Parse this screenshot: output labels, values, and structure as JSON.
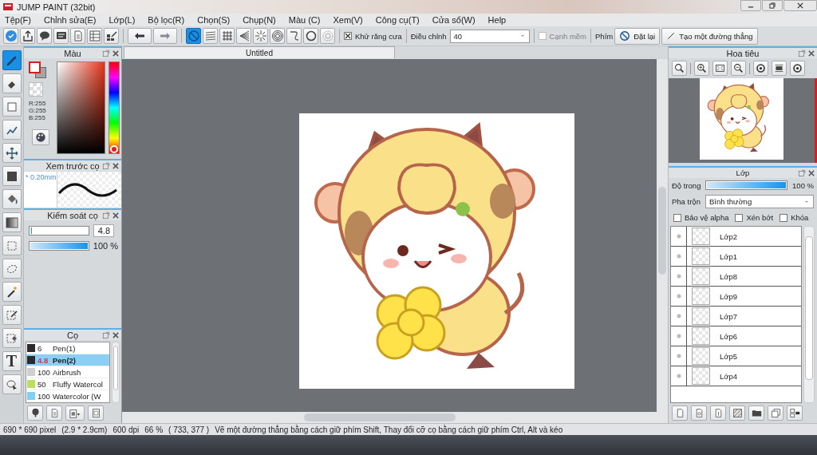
{
  "window": {
    "title": "JUMP PAINT (32bit)"
  },
  "menu": [
    "Tệp(F)",
    "Chỉnh sửa(E)",
    "Lớp(L)",
    "Bộ lọc(R)",
    "Chọn(S)",
    "Chụp(N)",
    "Màu (C)",
    "Xem(V)",
    "Công cụ(T)",
    "Cửa sổ(W)",
    "Help"
  ],
  "snap_tools": [
    {
      "kind": "no-symbol",
      "selected": true
    },
    {
      "kind": "parallel-lines",
      "selected": false
    },
    {
      "kind": "grid",
      "selected": false
    },
    {
      "kind": "fan-lines",
      "selected": false
    },
    {
      "kind": "burst",
      "selected": false
    },
    {
      "kind": "concentric",
      "selected": false
    },
    {
      "kind": "curve",
      "selected": false
    },
    {
      "kind": "circle",
      "selected": false
    },
    {
      "kind": "gear",
      "selected": false
    }
  ],
  "toolbar": {
    "antialias": {
      "label": "Khử răng cưa",
      "checked": true
    },
    "adjust": {
      "label": "Điều chỉnh",
      "value": "40"
    },
    "smooth": {
      "label": "Cạnh mềm",
      "checked": false,
      "disabled": true
    },
    "keys_label": "Phím",
    "reset_button": "Đặt lại",
    "line_button": "Tạo một đường thẳng"
  },
  "tools": [
    {
      "kind": "brush",
      "selected": true
    },
    {
      "kind": "eraser",
      "selected": false
    },
    {
      "kind": "rectangle",
      "selected": false
    },
    {
      "kind": "polyline",
      "selected": false
    },
    {
      "kind": "move",
      "selected": false
    },
    {
      "kind": "square",
      "selected": false
    },
    {
      "kind": "bucket",
      "selected": false
    },
    {
      "kind": "gradient",
      "selected": false
    },
    {
      "kind": "marquee",
      "selected": false
    },
    {
      "kind": "lasso",
      "selected": false
    },
    {
      "kind": "wand",
      "selected": false
    },
    {
      "kind": "select-pen",
      "selected": false
    },
    {
      "kind": "select-eraser",
      "selected": false
    },
    {
      "kind": "text",
      "glyph": "T",
      "selected": false
    },
    {
      "kind": "lasso-pointer",
      "selected": false
    }
  ],
  "color_panel": {
    "title": "Màu",
    "rgb": [
      "R:255",
      "G:255",
      "B:255"
    ],
    "hue": {
      "level": 0
    }
  },
  "brush_preview": {
    "title": "Xem trước cọ",
    "size": "* 0.20mm"
  },
  "brush_control": {
    "title": "Kiểm soát cọ",
    "size": {
      "level": 0.03,
      "reading": "4.8"
    },
    "opacity": {
      "level": 1,
      "reading": "100 %"
    }
  },
  "brushes": {
    "title": "Cọ",
    "items": [
      {
        "color": "#2b2b2b",
        "size": "6",
        "name": "Pen(1)",
        "selected": false
      },
      {
        "color": "#2b2b2b",
        "size": "4.8",
        "name": "Pen(2)",
        "selected": true
      },
      {
        "color": "#cfcfcf",
        "size": "100",
        "name": "Airbrush",
        "selected": false
      },
      {
        "color": "#b8e05a",
        "size": "50",
        "name": "Fluffy Watercol",
        "selected": false
      },
      {
        "color": "#7fd0f2",
        "size": "100",
        "name": "Watercolor (W",
        "selected": false
      }
    ]
  },
  "canvas": {
    "tab": "Untitled"
  },
  "navigator": {
    "title": "Hoa tiêu"
  },
  "layers": {
    "title": "Lớp",
    "opacity": {
      "label": "Độ trong",
      "level": 1,
      "reading": "100 %"
    },
    "blend": {
      "label": "Pha trộn",
      "value": "Bình thường"
    },
    "options": [
      {
        "label": "Bảo vệ alpha",
        "checked": false
      },
      {
        "label": "Xén bớt",
        "checked": false
      },
      {
        "label": "Khóa",
        "checked": false
      }
    ],
    "items": [
      {
        "name": "Lớp2"
      },
      {
        "name": "Lớp1"
      },
      {
        "name": "Lớp8"
      },
      {
        "name": "Lớp9"
      },
      {
        "name": "Lớp7"
      },
      {
        "name": "Lớp6"
      },
      {
        "name": "Lớp5"
      },
      {
        "name": "Lớp4"
      }
    ]
  },
  "status": [
    "690 * 690 pixel",
    "(2.9 * 2.9cm)",
    "600 dpi",
    "66 %",
    "( 733, 377 )",
    "Vẽ một đường thẳng bằng cách giữ phím Shift, Thay đổi cỡ cọ bằng cách giữ phím Ctrl, Alt và kéo"
  ]
}
